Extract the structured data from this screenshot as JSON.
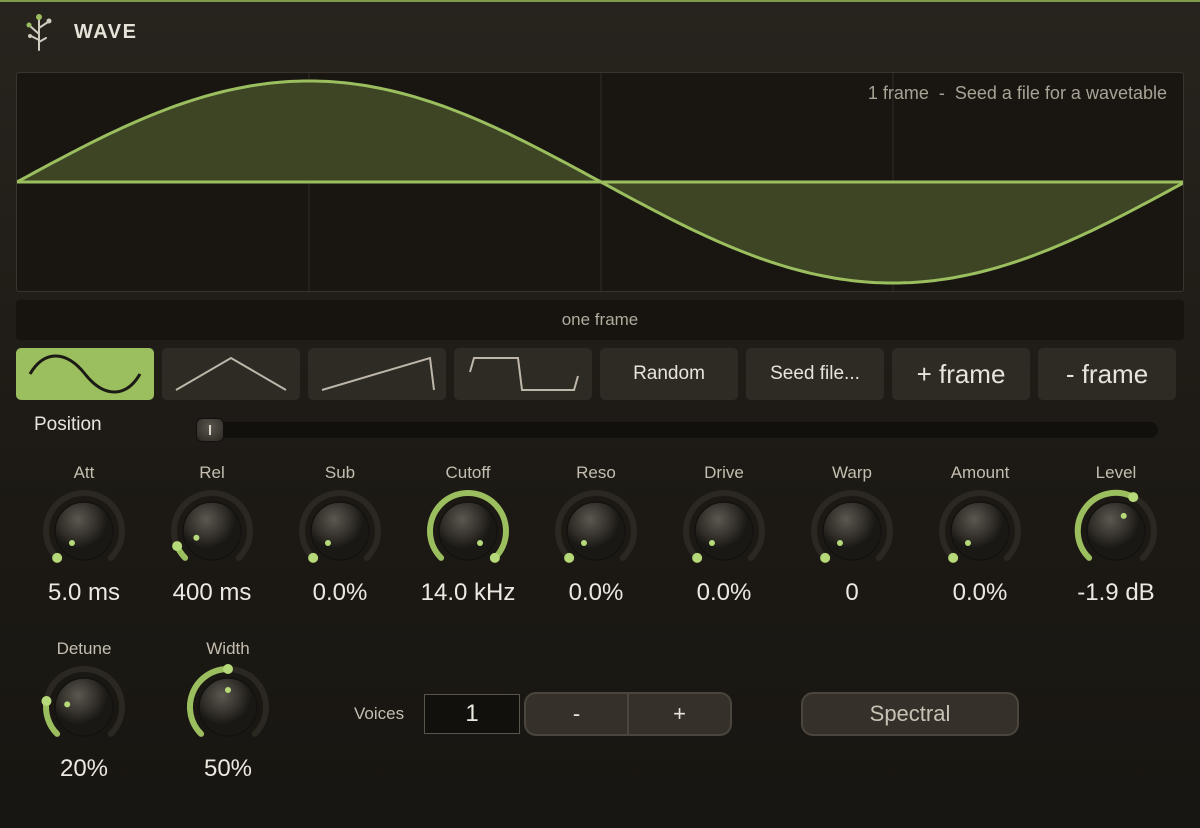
{
  "app": {
    "title": "WAVE",
    "logo_icon": "plant-sprout-icon",
    "accent": "#9bbe5e"
  },
  "wave_display": {
    "info": "1 frame  -  Seed a file for a wavetable",
    "waveform": "sine",
    "fill_color": "#3d4525",
    "line_color": "#9bbe5e"
  },
  "frame_bar": {
    "label": "one frame"
  },
  "shape_buttons": [
    {
      "icon": "sine-wave-icon",
      "active": true
    },
    {
      "icon": "triangle-wave-icon",
      "active": false
    },
    {
      "icon": "saw-wave-icon",
      "active": false
    },
    {
      "icon": "square-wave-icon",
      "active": false
    }
  ],
  "action_buttons": {
    "random": "Random",
    "seed_file": "Seed file...",
    "add_frame": "+ frame",
    "remove_frame": "- frame"
  },
  "position": {
    "label": "Position",
    "value_fraction": 0.0
  },
  "knobs": [
    {
      "id": "att",
      "label": "Att",
      "value": "5.0 ms",
      "fraction": 0.0
    },
    {
      "id": "rel",
      "label": "Rel",
      "value": "400 ms",
      "fraction": 0.08
    },
    {
      "id": "sub",
      "label": "Sub",
      "value": "0.0%",
      "fraction": 0.0
    },
    {
      "id": "cutoff",
      "label": "Cutoff",
      "value": "14.0 kHz",
      "fraction": 1.0
    },
    {
      "id": "reso",
      "label": "Reso",
      "value": "0.0%",
      "fraction": 0.0
    },
    {
      "id": "drive",
      "label": "Drive",
      "value": "0.0%",
      "fraction": 0.0
    },
    {
      "id": "warp",
      "label": "Warp",
      "value": "0",
      "fraction": 0.0
    },
    {
      "id": "amount",
      "label": "Amount",
      "value": "0.0%",
      "fraction": 0.0
    },
    {
      "id": "level",
      "label": "Level",
      "value": "-1.9 dB",
      "fraction": 0.6
    },
    {
      "id": "detune",
      "label": "Detune",
      "value": "20%",
      "fraction": 0.2
    },
    {
      "id": "width",
      "label": "Width",
      "value": "50%",
      "fraction": 0.5
    }
  ],
  "voices": {
    "label": "Voices",
    "value": "1",
    "minus": "-",
    "plus": "+"
  },
  "spectral": {
    "label": "Spectral"
  }
}
